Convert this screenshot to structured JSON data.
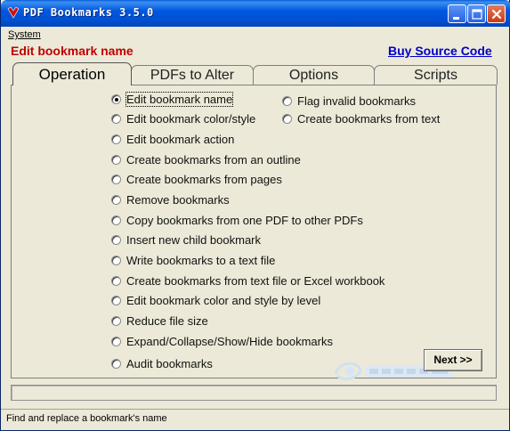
{
  "window": {
    "title": "PDF Bookmarks 3.5.0"
  },
  "menu": {
    "items": [
      "System"
    ]
  },
  "header": {
    "title": "Edit bookmark name",
    "link": "Buy Source Code"
  },
  "tabs": [
    {
      "label": "Operation",
      "active": true
    },
    {
      "label": "PDFs to Alter",
      "active": false
    },
    {
      "label": "Options",
      "active": false
    },
    {
      "label": "Scripts",
      "active": false
    }
  ],
  "operations": {
    "selected": "Edit bookmark name",
    "column1": [
      "Edit bookmark name",
      "Edit bookmark color/style",
      "Edit bookmark action",
      "Create bookmarks from an outline",
      "Create bookmarks from pages",
      "Remove bookmarks",
      "Copy bookmarks from one PDF to other PDFs",
      "Insert new child bookmark",
      "Write bookmarks to a text file",
      "Create bookmarks from text file or Excel workbook",
      "Edit bookmark color and style by level",
      "Reduce file size",
      "Expand/Collapse/Show/Hide bookmarks",
      "Audit bookmarks"
    ],
    "column2": [
      "Flag invalid bookmarks",
      "Create bookmarks from text"
    ]
  },
  "buttons": {
    "next": "Next >>"
  },
  "progress": {
    "value": 0
  },
  "status": {
    "text": "Find and replace a bookmark's name"
  },
  "colors": {
    "title_red": "#c00000",
    "link_blue": "#0000c8",
    "window_bg": "#ece9d8"
  },
  "icons": [
    "pdf-app-icon",
    "minimize-icon",
    "maximize-icon",
    "close-icon"
  ]
}
